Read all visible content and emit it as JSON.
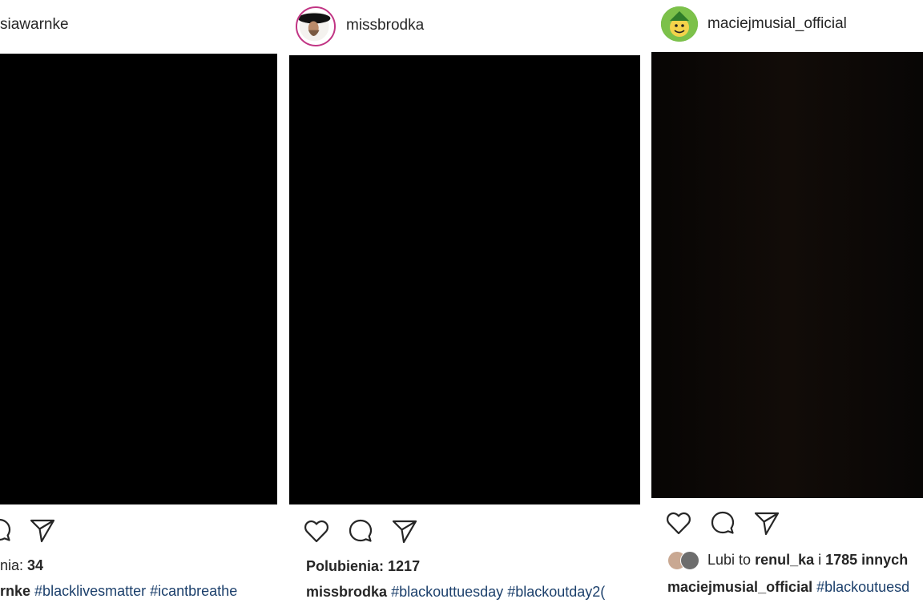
{
  "posts": [
    {
      "username": "siawarnke",
      "likes_label": "nia:",
      "likes_count": "34",
      "caption_user": "rnke",
      "hashtags": [
        "#blacklivesmatter",
        "#icantbreathe"
      ]
    },
    {
      "username": "missbrodka",
      "likes_label": "Polubienia:",
      "likes_count": "1217",
      "caption_user": "missbrodka",
      "hashtags": [
        "#blackouttuesday",
        "#blackoutday2("
      ]
    },
    {
      "username": "maciejmusial_official",
      "liked_prefix": "Lubi to",
      "liked_user": "renul_ka",
      "liked_joiner": "i",
      "liked_others": "1785 innych",
      "caption_user": "maciejmusial_official",
      "hashtags": [
        "#blackoutuesd"
      ]
    }
  ],
  "icons": [
    "heart-icon",
    "comment-icon",
    "share-icon"
  ],
  "colors": {
    "hashtag": "#1b3f6b",
    "text": "#262626",
    "image": "#000000",
    "ring": "#c13584"
  }
}
